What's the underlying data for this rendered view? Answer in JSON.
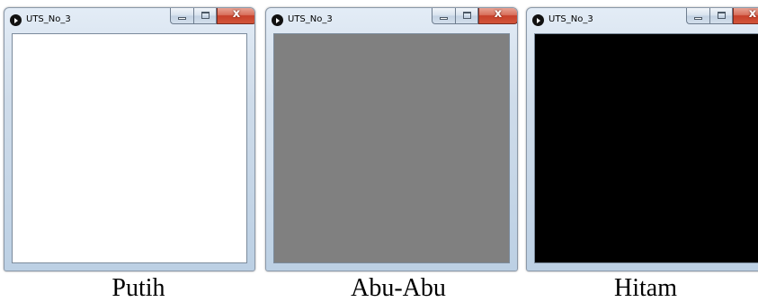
{
  "windows": [
    {
      "title": "UTS_No_3",
      "canvas_color": "#ffffff",
      "caption": "Putih"
    },
    {
      "title": "UTS_No_3",
      "canvas_color": "#808080",
      "caption": "Abu-Abu"
    },
    {
      "title": "UTS_No_3",
      "canvas_color": "#000000",
      "caption": "Hitam"
    }
  ],
  "icons": {
    "app": "processing-play-icon",
    "minimize": "minimize-icon",
    "maximize": "maximize-icon",
    "close": "close-icon"
  },
  "colors": {
    "close_button": "#c7402a",
    "frame": "#cfdcea"
  }
}
